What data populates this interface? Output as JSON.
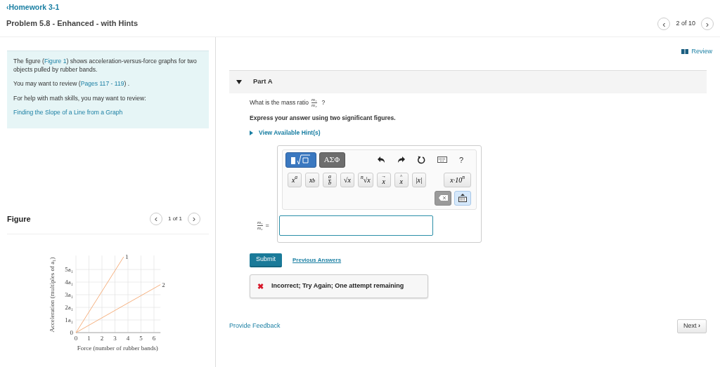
{
  "breadcrumb": {
    "arrow": "‹",
    "label": "Homework 3-1"
  },
  "title": "Problem 5.8 - Enhanced - with Hints",
  "pager": {
    "prev": "‹",
    "text": "2 of 10",
    "next": "›"
  },
  "intro": [
    {
      "parts": [
        {
          "text": "The figure ("
        },
        {
          "text": "Figure 1",
          "link": true
        },
        {
          "text": ") shows acceleration-versus-force graphs for two objects pulled by rubber bands."
        }
      ]
    },
    {
      "parts": [
        {
          "text": "You may want to review ("
        },
        {
          "text": "Pages 117 - 119",
          "link": true
        },
        {
          "text": ") ."
        }
      ]
    },
    {
      "parts": [
        {
          "text": "For help with math skills, you may want to review:"
        }
      ]
    },
    {
      "parts": [
        {
          "text": "Finding the Slope of a Line from a Graph",
          "link": true
        }
      ]
    }
  ],
  "figure": {
    "title": "Figure",
    "pager": {
      "prev": "‹",
      "text": "1 of 1",
      "next": "›"
    },
    "chart_data": {
      "type": "line",
      "xlabel": "Force (number of rubber bands)",
      "ylabel": "Acceleration (multiples of a₁)",
      "x": [
        0,
        3.67,
        6.5
      ],
      "series": [
        {
          "name": "1",
          "color": "#f6b07e",
          "values": [
            0,
            6,
            null
          ]
        },
        {
          "name": "2",
          "color": "#f6b07e",
          "values": [
            0,
            2.15,
            3.8
          ]
        }
      ],
      "xlim": [
        0,
        6.5
      ],
      "ylim": [
        0,
        6
      ],
      "xticks": [
        0,
        1,
        2,
        3,
        4,
        5,
        6
      ],
      "yticks": [
        {
          "value": 0,
          "label": "0"
        },
        {
          "value": 1,
          "label": "1a₁"
        },
        {
          "value": 2,
          "label": "2a₁"
        },
        {
          "value": 3,
          "label": "3a₁"
        },
        {
          "value": 4,
          "label": "4a₁"
        },
        {
          "value": 5,
          "label": "5a₁"
        }
      ],
      "grid": true
    }
  },
  "review": "Review",
  "part": {
    "title": "Part A",
    "expanded": true,
    "question": {
      "prefix": "What is the mass ratio",
      "numerator": "m₁",
      "denominator": "m₂",
      "suffix": "?"
    },
    "instruction": "Express your answer using two significant figures.",
    "hints": {
      "label": "View Available Hint(s)",
      "expanded": false
    },
    "editor": {
      "tabs": [
        {
          "kind": "templates",
          "selected": true
        },
        {
          "kind": "text",
          "label": "ΑΣΦ",
          "selected": false
        }
      ],
      "tools": [
        {
          "kind": "undo"
        },
        {
          "kind": "redo"
        },
        {
          "kind": "reset"
        },
        {
          "kind": "keyboard"
        },
        {
          "kind": "text",
          "label": "?"
        }
      ],
      "templates": [
        {
          "label": "x$^{a}$"
        },
        {
          "label": "x$_{b}$"
        },
        {
          "kind": "fraction",
          "top": "a",
          "bottom": "b"
        },
        {
          "label": "√x"
        },
        {
          "label": "$^{n}$√x"
        },
        {
          "kind": "accent",
          "accent": "→",
          "label": "x"
        },
        {
          "kind": "accent",
          "accent": "^",
          "label": "x"
        },
        {
          "label": "|x|"
        },
        {
          "label": "x·10$^{n}$",
          "wide": true
        }
      ]
    },
    "answer": {
      "numerator": "m₁",
      "denominator": "m₂",
      "equals": "="
    },
    "submit": "Submit",
    "previous": "Previous Answers",
    "feedback": {
      "kind": "incorrect",
      "icon": "✖",
      "text": "Incorrect; Try Again; One attempt remaining"
    }
  },
  "provide_feedback": "Provide Feedback",
  "next": {
    "label": "Next",
    "arrow": "›"
  }
}
